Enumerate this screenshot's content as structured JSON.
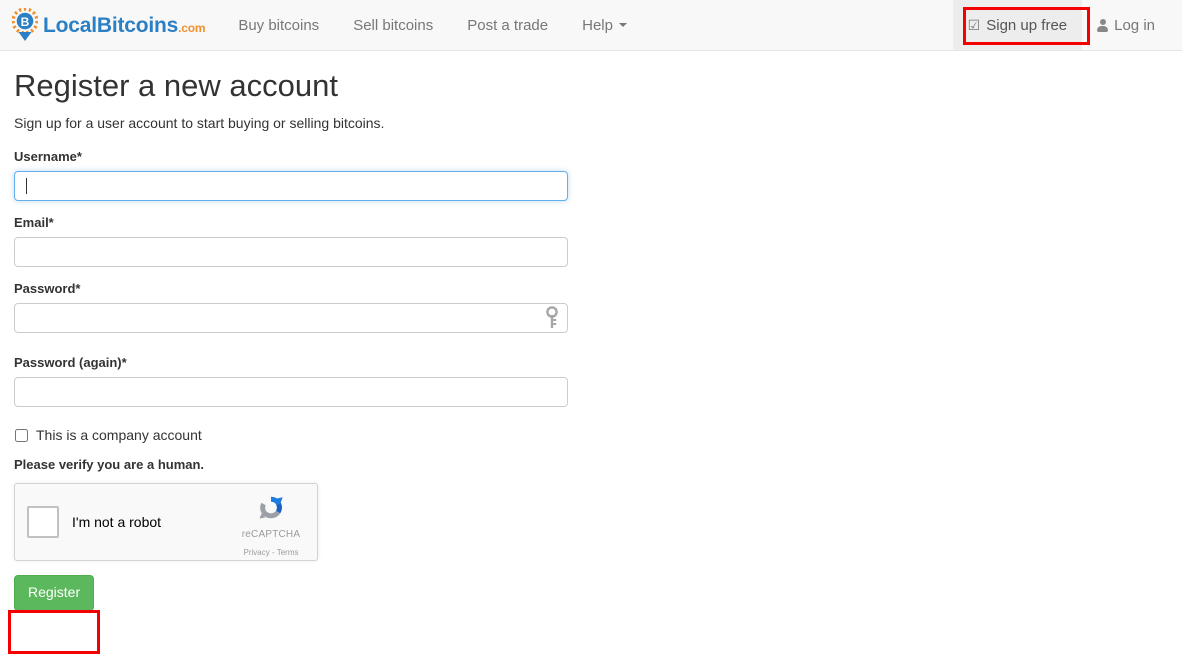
{
  "header": {
    "brand": {
      "name": "LocalBitcoins",
      "suffix": ".com",
      "logo_icon": "bitcoin-map-pin-icon",
      "brand_color": "#2b7fc4",
      "accent_color": "#f09030"
    },
    "nav_items": [
      {
        "label": "Buy bitcoins",
        "name": "nav-buy-bitcoins"
      },
      {
        "label": "Sell bitcoins",
        "name": "nav-sell-bitcoins"
      },
      {
        "label": "Post a trade",
        "name": "nav-post-a-trade"
      },
      {
        "label": "Help",
        "name": "nav-help",
        "has_caret": true
      }
    ],
    "right_items": {
      "signup_label": "Sign up free",
      "signup_icon": "checked-checkbox-icon",
      "signup_icon_glyph": "☑",
      "login_label": "Log in",
      "login_icon": "user-icon"
    }
  },
  "main": {
    "title": "Register a new account",
    "lead": "Sign up for a user account to start buying or selling bitcoins.",
    "fields": [
      {
        "label": "Username*",
        "name": "username-field",
        "value": "",
        "placeholder": "",
        "focused": true
      },
      {
        "label": "Email*",
        "name": "email-field",
        "value": "",
        "placeholder": "",
        "focused": false
      },
      {
        "label": "Password*",
        "name": "password-field",
        "value": "",
        "placeholder": "",
        "focused": false,
        "icon": "key-icon"
      },
      {
        "label": "Password (again)*",
        "name": "password-confirm-field",
        "value": "",
        "placeholder": "",
        "focused": false
      }
    ],
    "company_checkbox": {
      "label": "This is a company account",
      "checked": false
    },
    "verify_title": "Please verify you are a human.",
    "recaptcha": {
      "checkbox_label": "I'm not a robot",
      "checked": false,
      "brand_name": "reCAPTCHA",
      "links": "Privacy - Terms",
      "logo_icon": "recaptcha-logo-icon"
    },
    "submit_label": "Register",
    "submit_color": "#5cb85c"
  },
  "annotations": {
    "highlight_color": "#f40000",
    "boxes": [
      {
        "target": "signup-free-button"
      },
      {
        "target": "register-button"
      }
    ]
  }
}
